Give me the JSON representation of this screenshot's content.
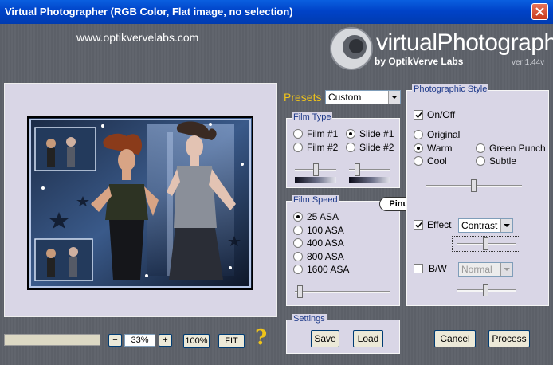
{
  "window": {
    "title": "Virtual Photographer (RGB Color, Flat image, no selection)"
  },
  "header": {
    "url": "www.optikvervelabs.com",
    "logo_title": "virtualPhotographer",
    "logo_sub": "by OptikVerve Labs",
    "version": "ver 1.44v"
  },
  "presets": {
    "label": "Presets",
    "value": "Custom"
  },
  "film_type": {
    "label": "Film Type",
    "options": [
      "Film #1",
      "Slide #1",
      "Film #2",
      "Slide #2"
    ],
    "selected": "Slide #1"
  },
  "film_speed": {
    "label": "Film Speed",
    "options": [
      "25 ASA",
      "100 ASA",
      "400 ASA",
      "800 ASA",
      "1600 ASA"
    ],
    "selected": "25 ASA"
  },
  "watermark": "Pinuccia",
  "photographic_style": {
    "label": "Photographic Style",
    "onoff_label": "On/Off",
    "onoff": true,
    "styles": [
      "Original",
      "Warm",
      "Green Punch",
      "Cool",
      "Subtle"
    ],
    "selected": "Warm",
    "effect_label": "Effect",
    "effect_checked": true,
    "effect_value": "Contrast",
    "bw_label": "B/W",
    "bw_checked": false,
    "bw_value": "Normal"
  },
  "settings": {
    "label": "Settings",
    "save": "Save",
    "load": "Load"
  },
  "zoom": {
    "minus": "−",
    "value": "33%",
    "plus": "+",
    "full": "100%",
    "fit": "FIT",
    "help": "?"
  },
  "actions": {
    "cancel": "Cancel",
    "process": "Process"
  },
  "colors": {
    "title_bar": "#0043c8",
    "panel": "#d9d6e6",
    "group_label": "#1e3a8a",
    "presets_label": "#f0c419",
    "help": "#f0c419"
  }
}
